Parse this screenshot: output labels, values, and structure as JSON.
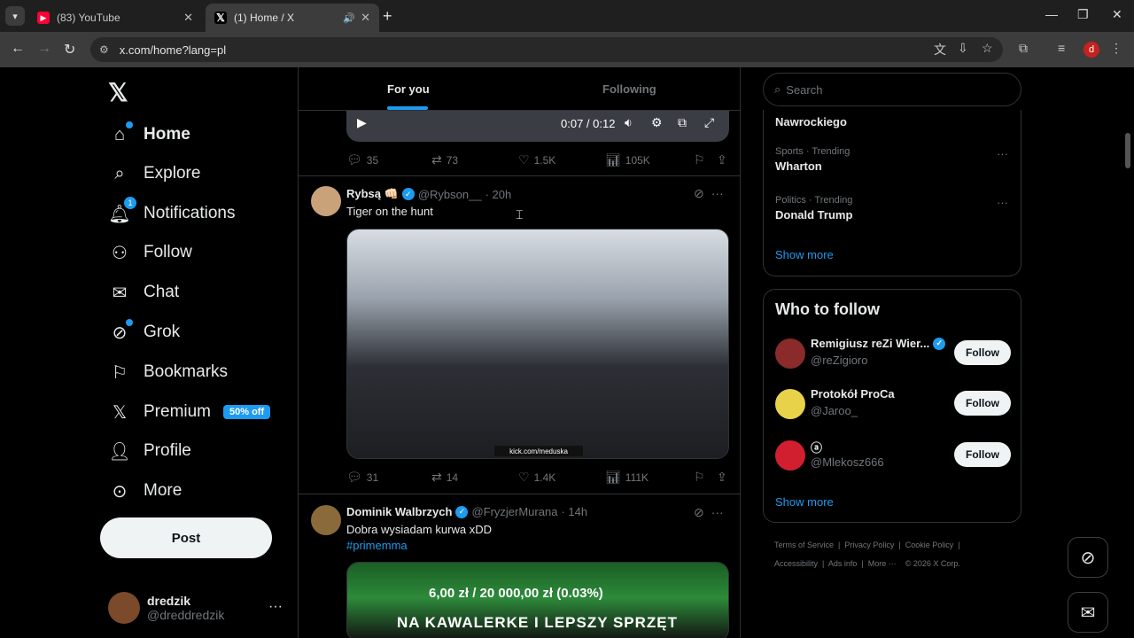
{
  "browser": {
    "tabs": [
      {
        "title": "(83) YouTube",
        "favicon": "youtube-icon"
      },
      {
        "title": "(1) Home / X",
        "favicon": "x-icon"
      }
    ],
    "url": "x.com/home?lang=pl"
  },
  "nav": {
    "items": [
      {
        "label": "Home",
        "icon": "home-icon"
      },
      {
        "label": "Explore",
        "icon": "search-icon"
      },
      {
        "label": "Notifications",
        "icon": "bell-icon",
        "badge": "1"
      },
      {
        "label": "Follow",
        "icon": "person-add-icon"
      },
      {
        "label": "Chat",
        "icon": "mail-icon"
      },
      {
        "label": "Grok",
        "icon": "grok-icon"
      },
      {
        "label": "Bookmarks",
        "icon": "bookmark-icon"
      },
      {
        "label": "Premium",
        "icon": "x-icon",
        "promo": "50% off"
      },
      {
        "label": "Profile",
        "icon": "person-icon"
      },
      {
        "label": "More",
        "icon": "more-circle-icon"
      }
    ],
    "post_label": "Post"
  },
  "account": {
    "name": "dredzik",
    "handle": "@dreddredzik"
  },
  "feed": {
    "tabs": [
      "For you",
      "Following"
    ],
    "video_time": "0:07 / 0:12",
    "top_actions": {
      "replies": "35",
      "reposts": "73",
      "likes": "1.5K",
      "views": "105K"
    },
    "posts": [
      {
        "name": "Rybsą 👊🏻",
        "handle": "@Rybson__",
        "time": "· 20h",
        "text": "Tiger on the hunt",
        "media_caption": "kick.com/meduska",
        "actions": {
          "replies": "31",
          "reposts": "14",
          "likes": "1.4K",
          "views": "111K"
        }
      },
      {
        "name": "Dominik Walbrzych",
        "handle": "@FryzjerMurana",
        "time": "· 14h",
        "text": "Dobra wysiadam kurwa xDD",
        "hashtag": "#primemma",
        "media_line1": "6,00 zł / 20 000,00 zł (0.03%)",
        "media_line2": "NA KAWALERKE I LEPSZY SPRZĘT"
      }
    ]
  },
  "sidebar": {
    "search_placeholder": "Search",
    "trends": [
      {
        "context": "",
        "title": "Nawrockiego"
      },
      {
        "context": "Sports · Trending",
        "title": "Wharton"
      },
      {
        "context": "Politics · Trending",
        "title": "Donald Trump"
      }
    ],
    "show_more": "Show more",
    "who_to_follow": {
      "title": "Who to follow",
      "accounts": [
        {
          "name": "Remigiusz reZi Wier...",
          "handle": "@reZigioro",
          "verified": true,
          "button": "Follow"
        },
        {
          "name": "Protokół ProCa",
          "handle": "@Jaroo_",
          "verified": false,
          "button": "Follow"
        },
        {
          "name": "ⓐ",
          "handle": "@Mlekosz666",
          "verified": false,
          "button": "Follow"
        }
      ],
      "show_more": "Show more"
    },
    "footer_line1": [
      "Terms of Service",
      "Privacy Policy",
      "Cookie Policy"
    ],
    "footer_line2": [
      "Accessibility",
      "Ads info",
      "More ···",
      "© 2026 X Corp."
    ]
  },
  "colors": {
    "accent": "#1d9bf0",
    "background": "#000000",
    "border": "#2f3336",
    "muted": "#71767b"
  }
}
